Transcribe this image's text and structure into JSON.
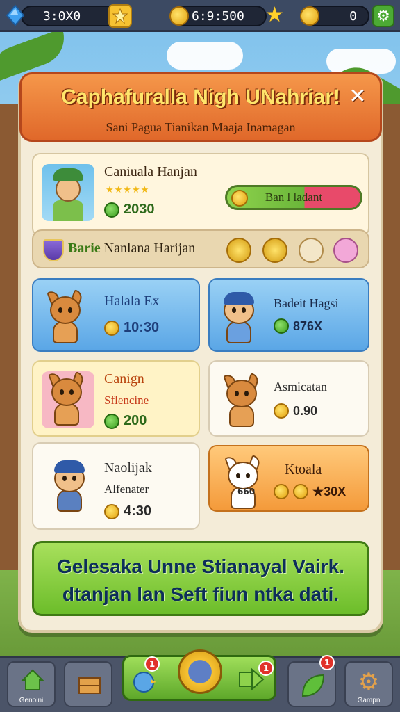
{
  "topbar": {
    "gems": "3:0X0",
    "coins": "6:9:500",
    "stars": "0",
    "plus_icon": "plus-icon",
    "settings_icon": "gear-icon"
  },
  "dialog": {
    "title": "Caphafuralla Nigh UNahriar!",
    "subtitle": "Sani Pagua Tianikan Maaja Inamagan",
    "close": "✕"
  },
  "hero": {
    "name": "Caniuala Hanjan",
    "stars": "★★★★★",
    "price": "2030",
    "progress_label": "Ban l ladant",
    "progress_fraction": 0.58
  },
  "strip": {
    "prefix": "Barie",
    "label": "Nanlana Harijan"
  },
  "cards": [
    {
      "title": "Halala Ex",
      "price": "10:30"
    },
    {
      "title": "Badeit Hagsi",
      "price": "876X"
    },
    {
      "title": "Canign",
      "subtitle": "Sflencine",
      "price": "200"
    },
    {
      "title": "Asmicatan",
      "price": "0.90"
    },
    {
      "title": "Naolijak",
      "subtitle": "Alfenater",
      "price": "4:30"
    },
    {
      "title": "Ktoala",
      "tag": "660",
      "price": "★30X"
    }
  ],
  "cta": {
    "line1": "Gelesaka Unne Stianayal Vairk.",
    "line2": "dtanjan lan Seft fiun ntka dati."
  },
  "nav": {
    "left_label": "Genoini",
    "right_label": "Gampn",
    "badge1": "1",
    "badge2": "1",
    "badge3": "1"
  }
}
